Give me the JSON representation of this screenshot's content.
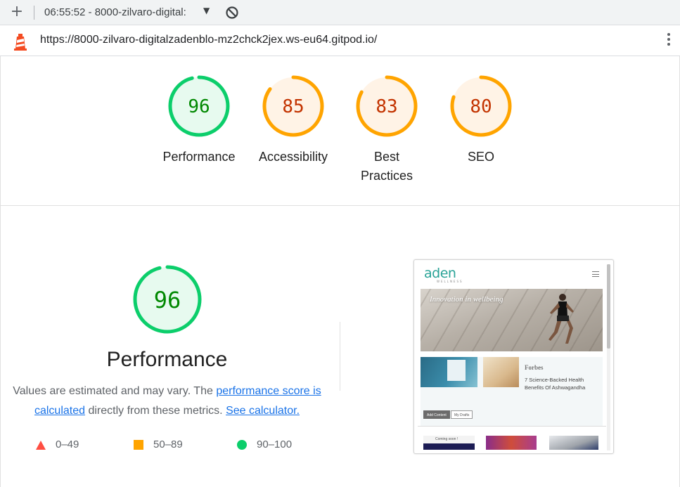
{
  "browser": {
    "tab_title": "06:55:52 - 8000-zilvaro-digital:",
    "url": "https://8000-zilvaro-digitalzadenblo-mz2chck2jex.ws-eu64.gitpod.io/"
  },
  "colors": {
    "pass": "#0cce6b",
    "pass_text": "#008800",
    "average": "#ffa400",
    "average_text": "#c33300",
    "fail": "#ff4e42",
    "link": "#1a73e8"
  },
  "gauges": [
    {
      "score": "96",
      "label": "Performance",
      "rating": "pass",
      "value": 0.96
    },
    {
      "score": "85",
      "label": "Accessibility",
      "rating": "average",
      "value": 0.85
    },
    {
      "score": "83",
      "label": "Best Practices",
      "rating": "average",
      "value": 0.83
    },
    {
      "score": "80",
      "label": "SEO",
      "rating": "average",
      "value": 0.8
    }
  ],
  "performance": {
    "score": "96",
    "value": 0.96,
    "title": "Performance",
    "desc_prefix": "Values are estimated and may vary. The ",
    "link_score": "performance score is calculated",
    "desc_middle": " directly from these metrics. ",
    "link_calculator": "See calculator."
  },
  "legend": {
    "fail": "0–49",
    "average": "50–89",
    "pass": "90–100"
  },
  "thumbnail": {
    "logo": "aden",
    "logo_sub": "WELLNESS",
    "hero_text": "Innovation in wellbeing",
    "source": "Forbes",
    "headline": "7 Science-Backed Health Benefits Of Ashwagandha",
    "btn_add": "Add Content",
    "btn_drafts": "My Drafts",
    "coming_soon": "Coming soon !"
  }
}
